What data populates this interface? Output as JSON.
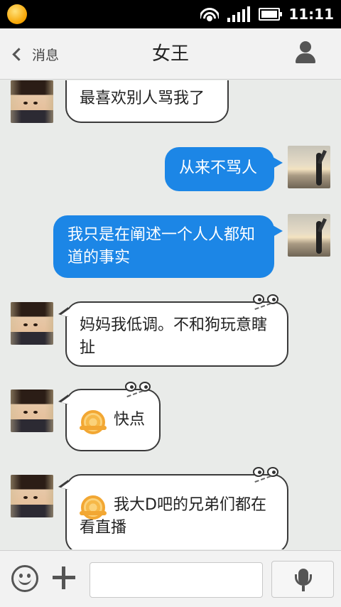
{
  "status_bar": {
    "time": "11:11"
  },
  "header": {
    "back_label": "消息",
    "title": "女王"
  },
  "messages": [
    {
      "direction": "in",
      "text": "最喜欢别人骂我了"
    },
    {
      "direction": "out",
      "text": "从来不骂人"
    },
    {
      "direction": "out",
      "text": "我只是在阐述一个人人都知道的事实"
    },
    {
      "direction": "in",
      "text": "妈妈我低调。不和狗玩意瞎扯"
    },
    {
      "direction": "in",
      "text": "快点",
      "emoji": "snail-emoji"
    },
    {
      "direction": "in",
      "text": "我大D吧的兄弟们都在看直播",
      "emoji": "snail-emoji"
    }
  ],
  "input": {
    "value": "",
    "placeholder": ""
  },
  "colors": {
    "outgoing_bubble": "#1c86e6",
    "chat_background": "#e9ebe9"
  },
  "icons": [
    "back-chevron-icon",
    "contact-person-icon",
    "emoji-smile-icon",
    "plus-icon",
    "microphone-icon",
    "wifi-icon",
    "signal-icon",
    "battery-icon"
  ]
}
